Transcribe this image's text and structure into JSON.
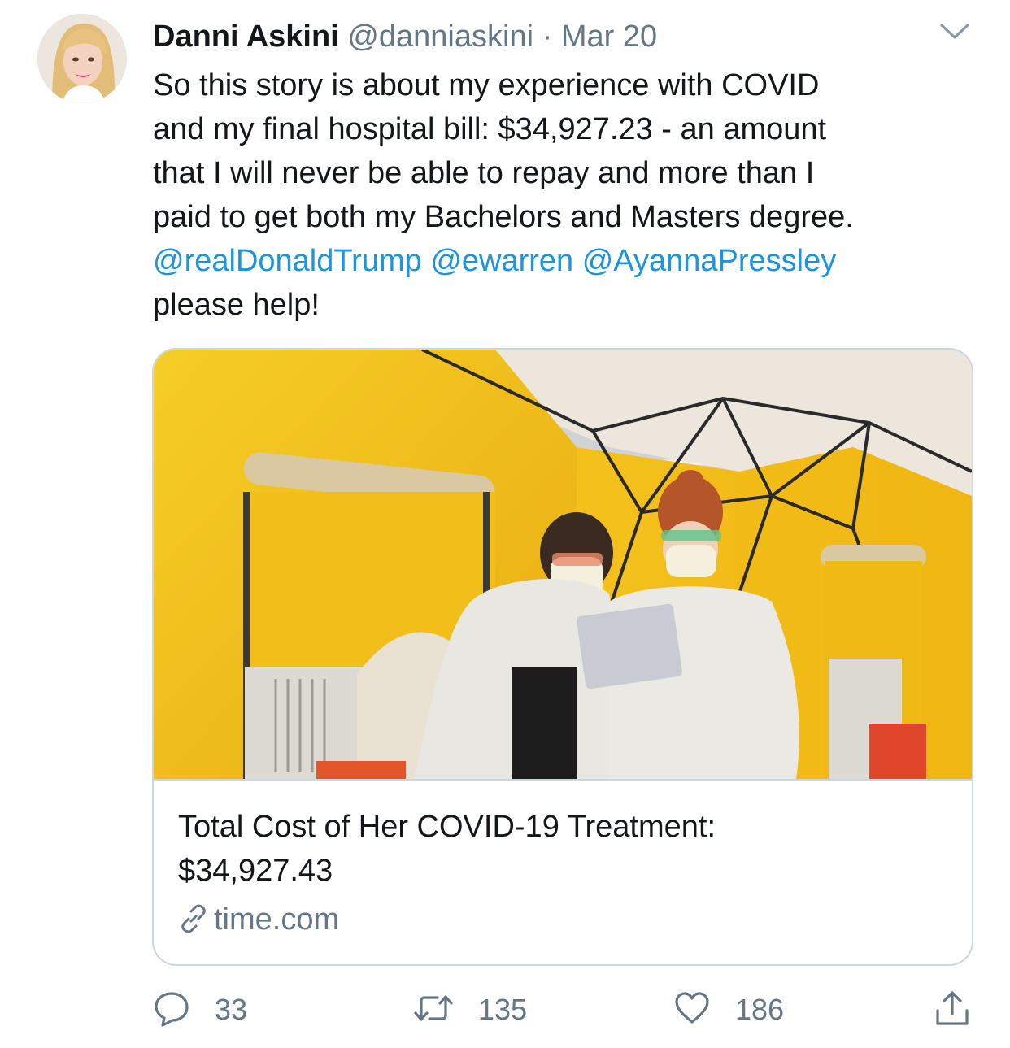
{
  "tweet": {
    "author_name": "Danni Askini",
    "handle": "@danniaskini",
    "separator": "·",
    "date": "Mar 20",
    "text_lines": [
      "So this story is about my experience with COVID",
      "and my final hospital bill: $34,927.23 - an amount",
      "that I will never be able to repay and more than I",
      "paid to get both my Bachelors and Masters degree."
    ],
    "mentions": [
      "@realDonaldTrump",
      "@ewarren",
      "@AyannaPressley"
    ],
    "text_tail": "please help!"
  },
  "card": {
    "title_lines": [
      "Total Cost of Her COVID-19 Treatment:",
      "$34,927.43"
    ],
    "domain": "time.com"
  },
  "actions": {
    "reply_count": "33",
    "retweet_count": "135",
    "like_count": "186"
  },
  "icons": {
    "caret": "chevron-down-icon",
    "reply": "reply-icon",
    "retweet": "retweet-icon",
    "like": "heart-icon",
    "share": "share-icon",
    "link": "link-icon"
  },
  "colors": {
    "link_blue": "#1b95e0",
    "secondary_text": "#657786",
    "border": "#ccd6dd",
    "tent_yellow": "#f2c21b"
  }
}
